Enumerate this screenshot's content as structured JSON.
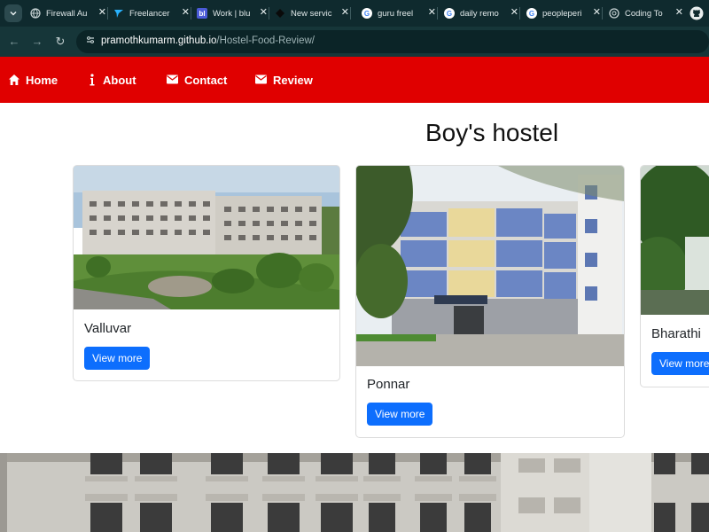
{
  "browser": {
    "tabs": [
      {
        "title": "Firewall Au",
        "favicon": "globe-icon",
        "color": "#9bb0b2"
      },
      {
        "title": "Freelancer",
        "favicon": "freelancer-icon",
        "color": "#29b2fe"
      },
      {
        "title": "Work | blu",
        "favicon": "bl-icon",
        "color": "#4b5bd8"
      },
      {
        "title": "New servic",
        "favicon": "diamond-icon",
        "color": "#111111"
      },
      {
        "title": "guru freel",
        "favicon": "google-icon",
        "color": "#ffffff"
      },
      {
        "title": "daily remo",
        "favicon": "google-icon",
        "color": "#ffffff"
      },
      {
        "title": "peopleperi",
        "favicon": "google-icon",
        "color": "#ffffff"
      },
      {
        "title": "Coding To",
        "favicon": "chatgpt-icon",
        "color": "#c8d3d4"
      }
    ],
    "url_host": "pramothkumarm.github.io",
    "url_path": "/Hostel-Food-Review/"
  },
  "navbar": {
    "color": "#e00000",
    "items": [
      {
        "label": "Home",
        "icon": "home-icon"
      },
      {
        "label": "About",
        "icon": "info-icon"
      },
      {
        "label": "Contact",
        "icon": "envelope-icon"
      },
      {
        "label": "Review",
        "icon": "envelope-icon"
      }
    ]
  },
  "main": {
    "heading": "Boy's hostel",
    "cards": [
      {
        "name": "Valluvar",
        "button": "View more"
      },
      {
        "name": "Ponnar",
        "button": "View more"
      },
      {
        "name": "Bharathi",
        "button": "View more"
      }
    ]
  },
  "colors": {
    "accent": "#0d6efd"
  }
}
